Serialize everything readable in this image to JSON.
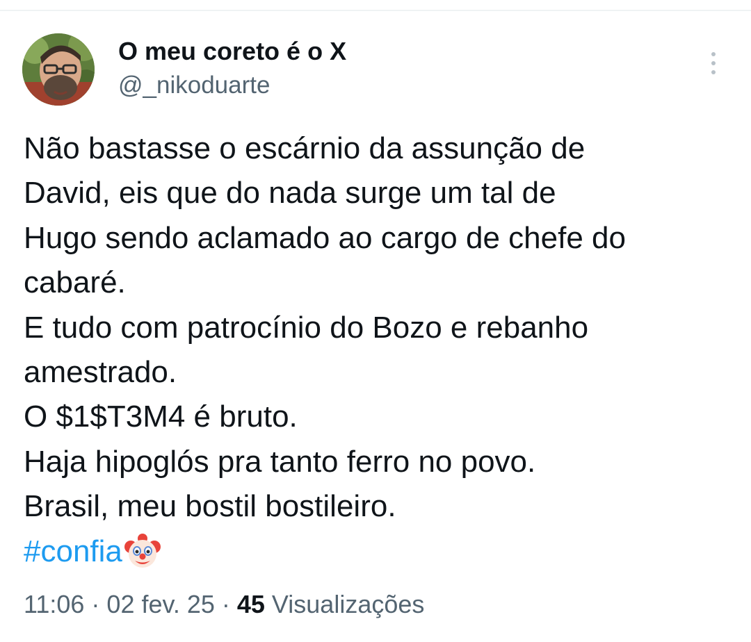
{
  "author": {
    "display_name": "O meu coreto é o X",
    "handle": "@_nikoduarte"
  },
  "tweet": {
    "lines": [
      "Não bastasse o escárnio da assunção de",
      "David, eis que do nada surge um tal de",
      "Hugo sendo aclamado ao cargo de chefe do",
      "cabaré.",
      "E tudo com patrocínio do Bozo e rebanho",
      "amestrado.",
      "O $1$T3M4 é bruto.",
      "Haja hipoglós pra tanto ferro no povo.",
      "Brasil, meu bostil bostileiro."
    ],
    "hashtag": "#confia",
    "emoji_icon": "clown-face-icon"
  },
  "meta": {
    "time": "11:06",
    "separator": " · ",
    "date": "02 fev. 25",
    "views_count": "45",
    "views_label": " Visualizações"
  },
  "colors": {
    "text": "#0f1419",
    "secondary": "#536471",
    "link": "#1d9bf0",
    "divider": "#eff3f4"
  },
  "icons": {
    "more": "more-vertical-icon",
    "avatar": "avatar-photo"
  }
}
